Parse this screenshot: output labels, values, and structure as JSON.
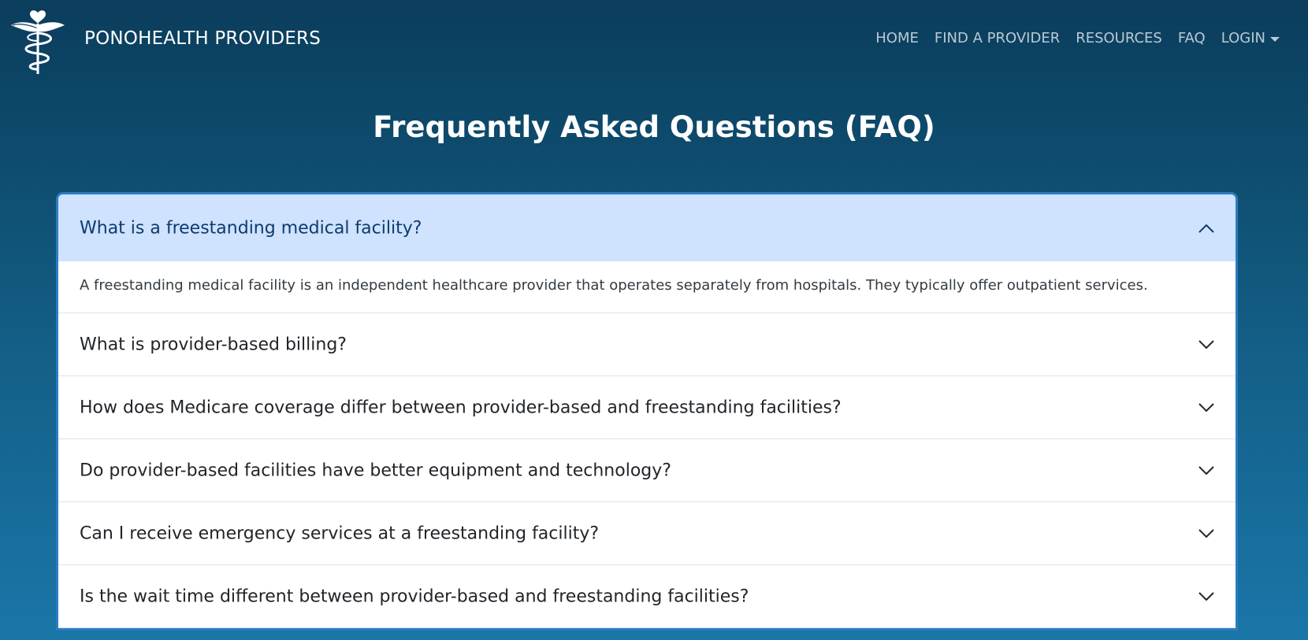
{
  "brand": {
    "name": "PONOHEALTH PROVIDERS",
    "logo_icon": "caduceus-heart-icon"
  },
  "nav": {
    "home": "HOME",
    "find_provider": "FIND A PROVIDER",
    "resources": "RESOURCES",
    "faq": "FAQ",
    "login": "LOGIN"
  },
  "page": {
    "title": "Frequently Asked Questions (FAQ)"
  },
  "faq": [
    {
      "question": "What is a freestanding medical facility?",
      "answer": "A freestanding medical facility is an independent healthcare provider that operates separately from hospitals. They typically offer outpatient services.",
      "expanded": true
    },
    {
      "question": "What is provider-based billing?",
      "expanded": false
    },
    {
      "question": "How does Medicare coverage differ between provider-based and freestanding facilities?",
      "expanded": false
    },
    {
      "question": "Do provider-based facilities have better equipment and technology?",
      "expanded": false
    },
    {
      "question": "Can I receive emergency services at a freestanding facility?",
      "expanded": false
    },
    {
      "question": "Is the wait time different between provider-based and freestanding facilities?",
      "expanded": false
    }
  ],
  "colors": {
    "background_top": "#0b3d5c",
    "background_bottom": "#1a76a8",
    "active_header": "#cfe2fe",
    "nav_text": "#b9cad6"
  }
}
